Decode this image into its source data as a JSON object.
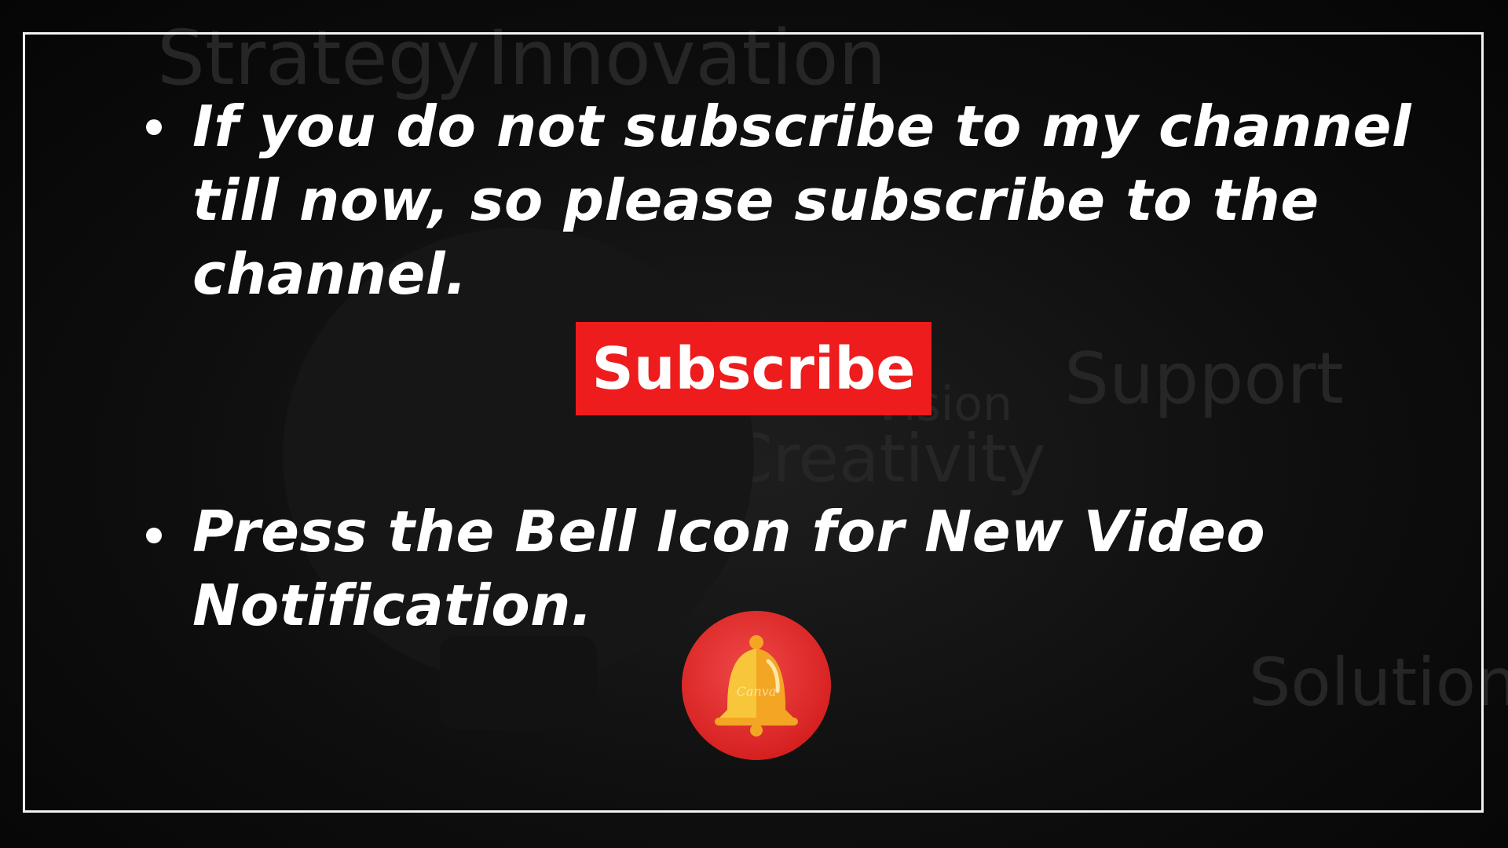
{
  "background_words": [
    "Strategy",
    "Innovation",
    "Support",
    "Vision",
    "Creativity",
    "Solution"
  ],
  "bullets": [
    {
      "lines": [
        "If you do not subscribe to my channel",
        "till now, so please subscribe to the",
        "channel."
      ]
    },
    {
      "lines": [
        "Press the Bell Icon for New Video",
        "Notification."
      ]
    }
  ],
  "subscribe_button": {
    "label": "Subscribe",
    "color": "#ee1c1c"
  },
  "bell": {
    "icon": "bell-icon",
    "circle_color": "#e32d2d",
    "bell_color": "#f7c63a",
    "watermark": "Canva"
  },
  "colors": {
    "text": "#ffffff",
    "frame": "#f2f2f2",
    "background": "#0b0b0b"
  }
}
